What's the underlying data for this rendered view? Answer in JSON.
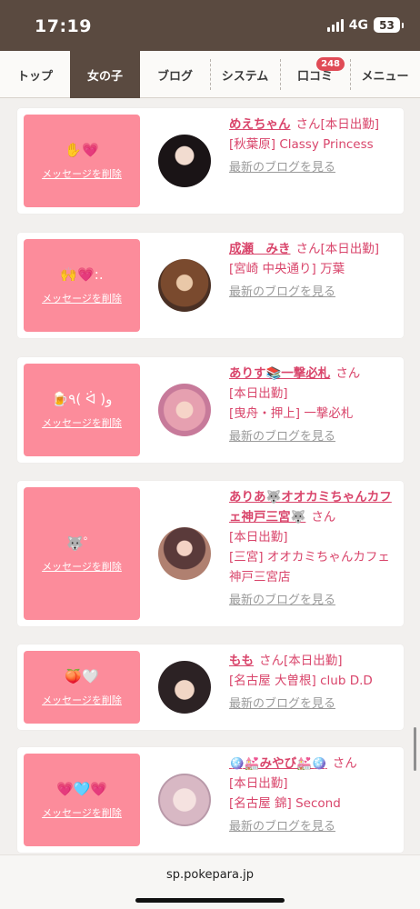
{
  "status": {
    "time": "17:19",
    "network": "4G",
    "battery": "53"
  },
  "nav": {
    "tabs": [
      {
        "label": "トップ",
        "icon": ""
      },
      {
        "label": "女の子",
        "icon": ""
      },
      {
        "label": "ブログ",
        "icon": ""
      },
      {
        "label": "システム",
        "icon": ""
      },
      {
        "label": "口コミ",
        "icon": ""
      },
      {
        "label": "メニュー",
        "icon": ""
      }
    ],
    "reviews_badge": "248",
    "active_tab": "女の子"
  },
  "cards": [
    {
      "emoji": "✋💗",
      "delete_label": "メッセージを削除",
      "name": "めえちゃん",
      "san": "さん",
      "status": "[本日出勤]",
      "location": "[秋葉原] Classy Princess",
      "blog_link": "最新のブログを見る"
    },
    {
      "emoji": "🙌💗:.",
      "delete_label": "メッセージを削除",
      "name": "成瀬　みき",
      "san": "さん",
      "status": "[本日出勤]",
      "location": "[宮崎 中央通り] 万葉",
      "blog_link": "最新のブログを見る"
    },
    {
      "emoji": "🍺٩( ᐛ )و",
      "delete_label": "メッセージを削除",
      "name": "ありす📚一撃必札",
      "san": "さん",
      "status": "[本日出勤]",
      "location": "[曳舟・押上] 一撃必札",
      "blog_link": "最新のブログを見る"
    },
    {
      "emoji": "🐺゜",
      "delete_label": "メッセージを削除",
      "name": "ありあ🐺オオカミちゃんカフェ神戸三宮🐺",
      "san": "さん",
      "status": "[本日出勤]",
      "location": "[三宮] オオカミちゃんカフェ神戸三宮店",
      "blog_link": "最新のブログを見る"
    },
    {
      "emoji": "🍑🤍",
      "delete_label": "メッセージを削除",
      "name": "もも",
      "san": "さん",
      "status": "[本日出勤]",
      "location": "[名古屋 大曽根] club D.D",
      "blog_link": "最新のブログを見る"
    },
    {
      "emoji": "💗🩵💗",
      "delete_label": "メッセージを削除",
      "name": "🪩💒みやび💒🪩",
      "san": "さん",
      "status": "[本日出勤]",
      "location": "[名古屋 錦] Second",
      "blog_link": "最新のブログを見る"
    }
  ],
  "browser": {
    "url": "sp.pokepara.jp"
  },
  "colors": {
    "header_bg": "#5a4a40",
    "accent_pink": "#fc8c9b",
    "name_pink": "#d9456b"
  }
}
